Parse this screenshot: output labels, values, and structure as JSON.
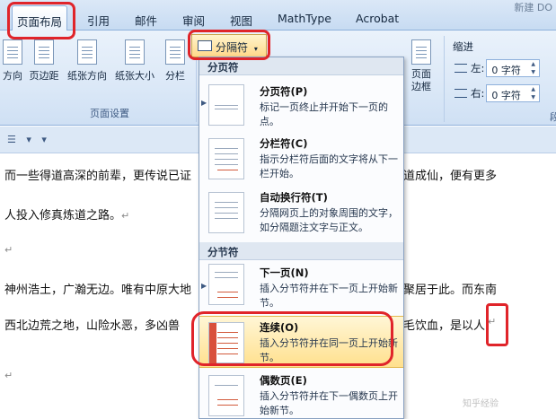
{
  "ribbon_tabs": [
    {
      "label": "页面布局",
      "active": true
    },
    {
      "label": "引用"
    },
    {
      "label": "邮件"
    },
    {
      "label": "审阅"
    },
    {
      "label": "视图"
    },
    {
      "label": "MathType"
    },
    {
      "label": "Acrobat"
    }
  ],
  "title_fragment": "新建 DO",
  "ribbon": {
    "buttons": [
      "方向",
      "页边距",
      "纸张方向",
      "纸张大小",
      "分栏"
    ],
    "group_label": "页面设置",
    "breaks_label": "分隔符",
    "page_border_label": "页面\n边框",
    "indent": {
      "title": "缩进",
      "left_label": "左:",
      "left_value": "0 字符",
      "right_label": "右:",
      "right_value": "0 字符"
    },
    "right_fragment": "段"
  },
  "menu": {
    "section_page": "分页符",
    "section_section": "分节符",
    "items": [
      {
        "title": "分页符(P)",
        "desc": "标记一页终止并开始下一页的点。"
      },
      {
        "title": "分栏符(C)",
        "desc": "指示分栏符后面的文字将从下一栏开始。"
      },
      {
        "title": "自动换行符(T)",
        "desc": "分隔网页上的对象周围的文字，如分隔题注文字与正文。"
      },
      {
        "title": "下一页(N)",
        "desc": "插入分节符并在下一页上开始新节。"
      },
      {
        "title": "连续(O)",
        "desc": "插入分节符并在同一页上开始新节。",
        "highlighted": true
      },
      {
        "title": "偶数页(E)",
        "desc": "插入分节符并在下一偶数页上开始新节。"
      }
    ]
  },
  "document": {
    "lines": [
      {
        "text": "而一些得道高深的前辈，更传说已证",
        "tail": "道成仙，便有更多"
      },
      {
        "text": "人投入修真炼道之路。",
        "tail": ""
      },
      {
        "text": "",
        "tail": ""
      },
      {
        "text": "神州浩土，广瀚无边。唯有中原大地",
        "tail": "聚居于此。而东南"
      },
      {
        "text": "西北边荒之地，山险水恶，多凶兽",
        "tail": "毛饮血，是以人"
      },
      {
        "text": "",
        "tail": ""
      }
    ],
    "paragraph_mark": "↵"
  },
  "watermark": "知乎经验"
}
